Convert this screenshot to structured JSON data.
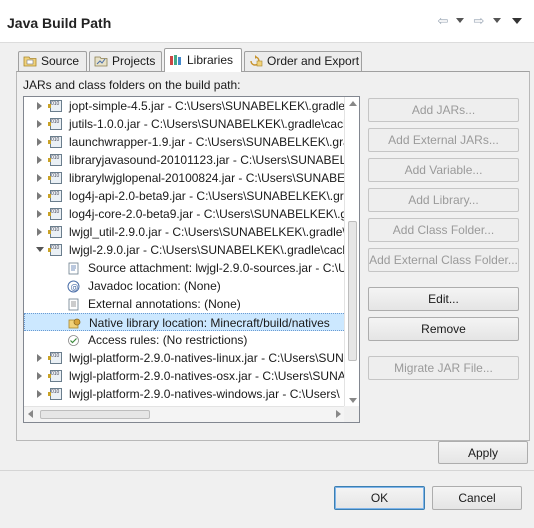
{
  "window": {
    "title": "Java Build Path"
  },
  "nav": {
    "back_icon": "back-arrow-icon",
    "forward_icon": "forward-arrow-icon",
    "menu_icon": "view-menu-icon"
  },
  "tabs": [
    {
      "label": "Source",
      "icon": "source-folder-icon",
      "active": false
    },
    {
      "label": "Projects",
      "icon": "project-folder-icon",
      "active": false
    },
    {
      "label": "Libraries",
      "icon": "libraries-icon",
      "active": true
    },
    {
      "label": "Order and Export",
      "icon": "order-export-icon",
      "active": false
    }
  ],
  "panel": {
    "label": "JARs and class folders on the build path:"
  },
  "tree": {
    "rows": [
      {
        "kind": "jar",
        "expanded": false,
        "text": "jopt-simple-4.5.jar - C:\\Users\\SUNABELKEK\\.gradle\\"
      },
      {
        "kind": "jar",
        "expanded": false,
        "text": "jutils-1.0.0.jar - C:\\Users\\SUNABELKEK\\.gradle\\cache"
      },
      {
        "kind": "jar",
        "expanded": false,
        "text": "launchwrapper-1.9.jar - C:\\Users\\SUNABELKEK\\.grad"
      },
      {
        "kind": "jar",
        "expanded": false,
        "text": "libraryjavasound-20101123.jar - C:\\Users\\SUNABELKEK"
      },
      {
        "kind": "jar",
        "expanded": false,
        "text": "librarylwjglopenal-20100824.jar - C:\\Users\\SUNABEL"
      },
      {
        "kind": "jar",
        "expanded": false,
        "text": "log4j-api-2.0-beta9.jar - C:\\Users\\SUNABELKEK\\.gra"
      },
      {
        "kind": "jar",
        "expanded": false,
        "text": "log4j-core-2.0-beta9.jar - C:\\Users\\SUNABELKEK\\.gr"
      },
      {
        "kind": "jar",
        "expanded": false,
        "text": "lwjgl_util-2.9.0.jar - C:\\Users\\SUNABELKEK\\.gradle\\c"
      },
      {
        "kind": "jar",
        "expanded": true,
        "text": "lwjgl-2.9.0.jar - C:\\Users\\SUNABELKEK\\.gradle\\cache"
      },
      {
        "kind": "child",
        "icon": "source-attachment-icon",
        "text": "Source attachment: lwjgl-2.9.0-sources.jar - C:\\U"
      },
      {
        "kind": "child",
        "icon": "javadoc-icon",
        "text": "Javadoc location: (None)"
      },
      {
        "kind": "child",
        "icon": "external-annotations-icon",
        "text": "External annotations: (None)"
      },
      {
        "kind": "child",
        "icon": "native-library-icon",
        "text": "Native library location: Minecraft/build/natives",
        "selected": true
      },
      {
        "kind": "child",
        "icon": "access-rules-icon",
        "text": "Access rules: (No restrictions)"
      },
      {
        "kind": "jar",
        "expanded": false,
        "text": "lwjgl-platform-2.9.0-natives-linux.jar - C:\\Users\\SUN"
      },
      {
        "kind": "jar",
        "expanded": false,
        "text": "lwjgl-platform-2.9.0-natives-osx.jar - C:\\Users\\SUNA"
      },
      {
        "kind": "jar",
        "expanded": false,
        "text": "lwjgl-platform-2.9.0-natives-windows.jar - C:\\Users\\"
      }
    ]
  },
  "side_buttons": [
    {
      "label": "Add JARs...",
      "enabled": false
    },
    {
      "label": "Add External JARs...",
      "enabled": false
    },
    {
      "label": "Add Variable...",
      "enabled": false
    },
    {
      "label": "Add Library...",
      "enabled": false
    },
    {
      "label": "Add Class Folder...",
      "enabled": false
    },
    {
      "label": "Add External Class Folder...",
      "enabled": false
    },
    {
      "label": "Edit...",
      "enabled": true
    },
    {
      "label": "Remove",
      "enabled": true
    },
    {
      "label": "Migrate JAR File...",
      "enabled": false
    }
  ],
  "footer": {
    "apply_label": "Apply",
    "ok_label": "OK",
    "cancel_label": "Cancel"
  },
  "colors": {
    "selection": "#cce8ff",
    "default_button_border": "#3c7fb1"
  }
}
